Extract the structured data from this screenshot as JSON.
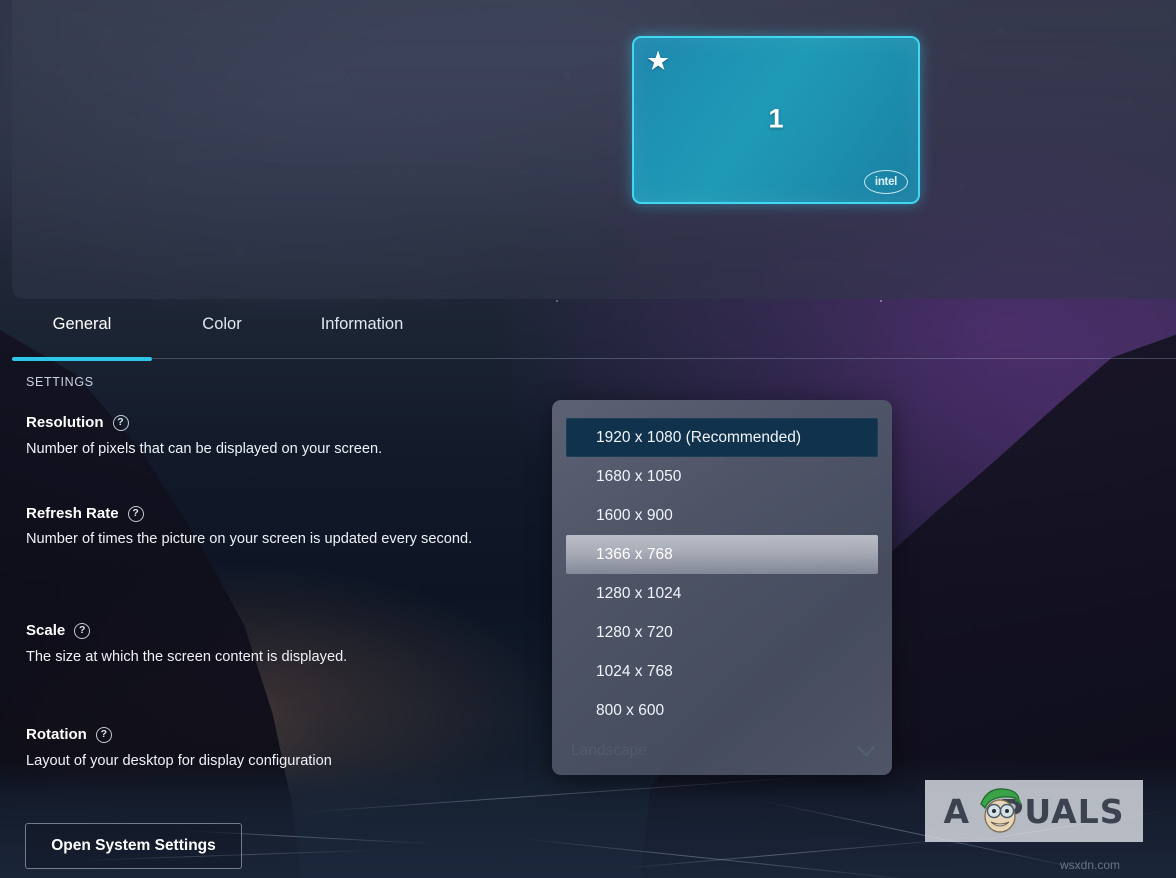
{
  "preview": {
    "monitor": {
      "number": "1",
      "star_icon": "star-icon",
      "brand_logo": "intel-logo",
      "brand_label": "intel"
    }
  },
  "tabs": [
    {
      "label": "General",
      "active": true
    },
    {
      "label": "Color",
      "active": false
    },
    {
      "label": "Information",
      "active": false
    }
  ],
  "settings": {
    "section_label": "SETTINGS",
    "help_glyph": "?",
    "rows": [
      {
        "title": "Resolution",
        "description": "Number of pixels that can be displayed on your screen."
      },
      {
        "title": "Refresh Rate",
        "description": "Number of times the picture on your screen is updated every second."
      },
      {
        "title": "Scale",
        "description": "The size at which the screen content is displayed."
      },
      {
        "title": "Rotation",
        "description": "Layout of your desktop for display configuration"
      }
    ]
  },
  "rotation_select": {
    "value": "Landscape",
    "chevron_icon": "chevron-down-icon"
  },
  "resolution_dropdown": {
    "open": true,
    "options": [
      {
        "label": "1920 x 1080 (Recommended)",
        "state": "selected"
      },
      {
        "label": "1680 x 1050",
        "state": "normal"
      },
      {
        "label": "1600 x 900",
        "state": "normal"
      },
      {
        "label": "1366 x 768",
        "state": "hovered"
      },
      {
        "label": "1280 x 1024",
        "state": "normal"
      },
      {
        "label": "1280 x 720",
        "state": "normal"
      },
      {
        "label": "1024 x 768",
        "state": "normal"
      },
      {
        "label": "800 x 600",
        "state": "normal"
      }
    ]
  },
  "actions": {
    "open_system_settings": "Open System Settings"
  },
  "watermark": {
    "brand_a": "A",
    "brand_rest": "PUALS",
    "url": "wsxdn.com"
  },
  "colors": {
    "accent_cyan": "#2ec6e8",
    "monitor_teal": "#1f9ab6",
    "monitor_border": "#3fd8f2",
    "selected_item_bg": "#10324d",
    "text_primary": "#ffffff"
  }
}
